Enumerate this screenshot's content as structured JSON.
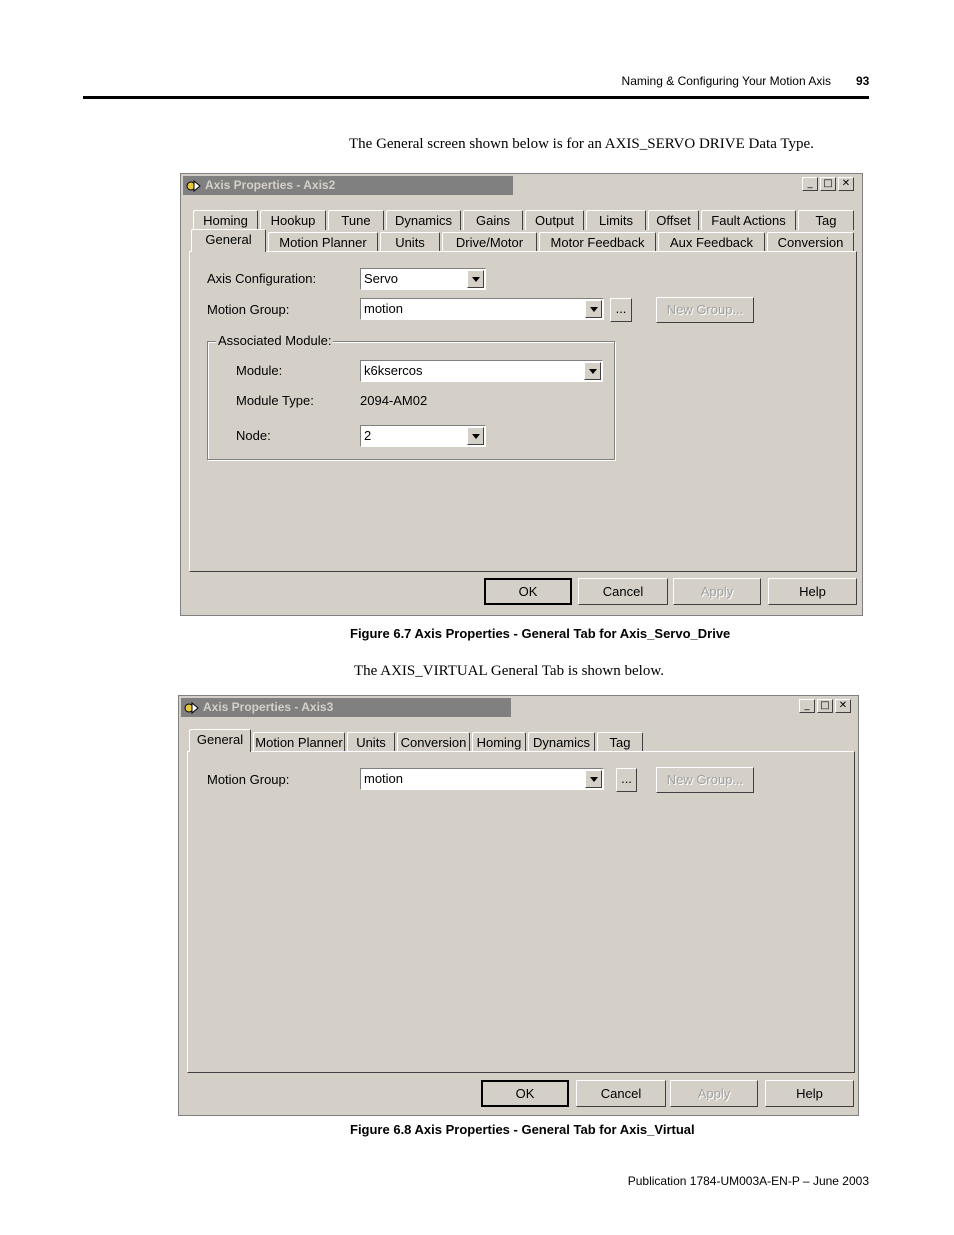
{
  "header": {
    "title": "Naming & Configuring Your Motion Axis",
    "page_number": "93"
  },
  "intro1": "The General screen shown below is for an AXIS_SERVO DRIVE Data Type.",
  "dialog1": {
    "title": "Axis Properties - Axis2",
    "tabs_back": [
      "Homing",
      "Hookup",
      "Tune",
      "Dynamics",
      "Gains",
      "Output",
      "Limits",
      "Offset",
      "Fault Actions",
      "Tag"
    ],
    "tabs_front": [
      "General",
      "Motion Planner",
      "Units",
      "Drive/Motor",
      "Motor Feedback",
      "Aux Feedback",
      "Conversion"
    ],
    "axis_config_label": "Axis Configuration:",
    "axis_config_value": "Servo",
    "motion_group_label": "Motion Group:",
    "motion_group_value": "motion",
    "ellipsis_label": "...",
    "new_group_label": "New Group...",
    "assoc_title": "Associated Module:",
    "module_label": "Module:",
    "module_value": "k6ksercos",
    "module_type_label": "Module Type:",
    "module_type_value": "2094-AM02",
    "node_label": "Node:",
    "node_value": "2",
    "buttons": {
      "ok": "OK",
      "cancel": "Cancel",
      "apply": "Apply",
      "help": "Help"
    }
  },
  "caption1": "Figure 6.7 Axis Properties - General Tab for Axis_Servo_Drive",
  "intro2": "The AXIS_VIRTUAL General Tab is shown below.",
  "dialog2": {
    "title": "Axis Properties - Axis3",
    "tabs": [
      "General",
      "Motion Planner",
      "Units",
      "Conversion",
      "Homing",
      "Dynamics",
      "Tag"
    ],
    "motion_group_label": "Motion Group:",
    "motion_group_value": "motion",
    "ellipsis_label": "...",
    "new_group_label": "New Group...",
    "buttons": {
      "ok": "OK",
      "cancel": "Cancel",
      "apply": "Apply",
      "help": "Help"
    }
  },
  "caption2": "Figure 6.8 Axis Properties - General Tab for Axis_Virtual",
  "footer": "Publication 1784-UM003A-EN-P – June 2003",
  "window_buttons": {
    "minimize": "_",
    "maximize": "□",
    "close": "✕"
  },
  "colors": {
    "dialog_face": "#d4d0c8",
    "inactive_title": "#808080"
  }
}
